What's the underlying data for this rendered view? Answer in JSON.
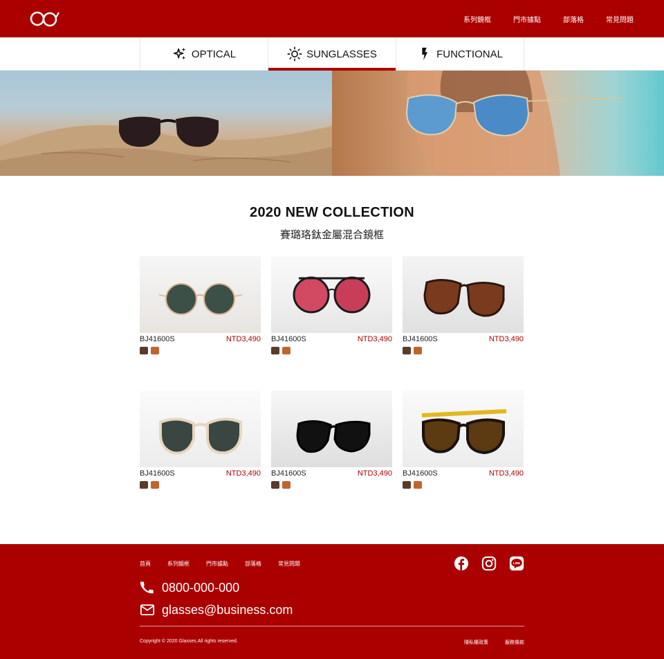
{
  "header": {
    "logo_icon": "glasses-logo-icon",
    "nav": [
      "系列鏡框",
      "門市據點",
      "部落格",
      "常見問題"
    ]
  },
  "tabs": [
    {
      "label": "OPTICAL",
      "icon": "sparkle-icon",
      "active": false
    },
    {
      "label": "SUNGLASSES",
      "icon": "sun-icon",
      "active": true
    },
    {
      "label": "FUNCTIONAL",
      "icon": "bolt-icon",
      "active": false
    }
  ],
  "collection": {
    "title": "2020 NEW COLLECTION",
    "subtitle": "賽璐珞鈦金屬混合鏡框"
  },
  "products": [
    {
      "name": "BJ41600S",
      "price": "NTD3,490",
      "swatches": [
        "#5a3a2a",
        "#c0642e"
      ]
    },
    {
      "name": "BJ41600S",
      "price": "NTD3,490",
      "swatches": [
        "#5a3a2a",
        "#c0642e"
      ]
    },
    {
      "name": "BJ41600S",
      "price": "NTD3,490",
      "swatches": [
        "#5a3a2a",
        "#c0642e"
      ]
    },
    {
      "name": "BJ41600S",
      "price": "NTD3,490",
      "swatches": [
        "#5a3a2a",
        "#c0642e"
      ]
    },
    {
      "name": "BJ41600S",
      "price": "NTD3,490",
      "swatches": [
        "#5a3a2a",
        "#c0642e"
      ]
    },
    {
      "name": "BJ41600S",
      "price": "NTD3,490",
      "swatches": [
        "#5a3a2a",
        "#c0642e"
      ]
    }
  ],
  "footer": {
    "nav": [
      "首頁",
      "系列鏡框",
      "門市據點",
      "部落格",
      "常見問題"
    ],
    "social": [
      "facebook-icon",
      "instagram-icon",
      "line-icon"
    ],
    "phone": "0800-000-000",
    "email": "glasses@business.com",
    "copyright": "Copyright © 2020 Glasses.All rights reserved.",
    "legal": [
      "隱私權政策",
      "服務條款"
    ]
  },
  "colors": {
    "brand": "#ab0000",
    "price": "#b00000"
  }
}
